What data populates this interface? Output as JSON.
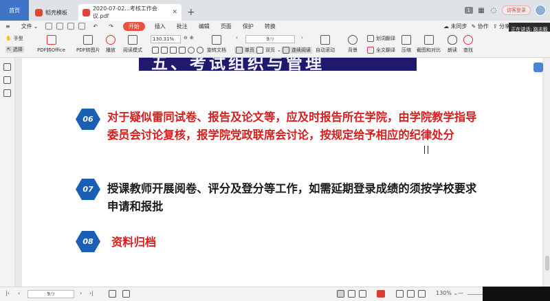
{
  "tabs": {
    "home": "首页",
    "template": "稻壳模板",
    "document": "2020-07-02...考核工作会议.pdf",
    "count_badge": "1",
    "login": "访客登录"
  },
  "menu": {
    "file": "文件",
    "start": "开始",
    "items": [
      "插入",
      "批注",
      "编辑",
      "页面",
      "保护",
      "转换"
    ],
    "sync": "未同步",
    "collab": "协作",
    "share": "分享"
  },
  "speaking_banner": "正在讲话: 路志毅",
  "toolbar": {
    "hand": "手型",
    "select": "选择",
    "pdf_to_office": "PDF转Office",
    "pdf_to_image": "PDF转图片",
    "play": "播放",
    "read_mode": "阅读模式",
    "zoom": "130.31%",
    "rotate": "旋转文档",
    "page_current": "9",
    "page_total": "/9",
    "single": "单页",
    "double": "双页",
    "continuous": "连续阅读",
    "auto_scroll": "自动滚动",
    "background": "背景",
    "word_translate": "划词翻译",
    "full_translate": "全文翻译",
    "compress": "压缩",
    "crop_compare": "截图和对比",
    "read_aloud": "朗读",
    "find": "查找"
  },
  "document": {
    "title": "五、考试组织与管理",
    "items": [
      {
        "num": "06",
        "lines": [
          "对于疑似雷同试卷、报告及论文等，应及时报告所在学院，由学院教学指导",
          "委员会讨论复核，报学院党政联席会讨论，按规定给予相应的纪律处分"
        ],
        "color": "#d81f1f"
      },
      {
        "num": "07",
        "lines": [
          "授课教师开展阅卷、评分及登分等工作，如需延期登录成绩的须按学校要求",
          "申请和报批"
        ],
        "color": "#1b1b1b"
      },
      {
        "num": "08",
        "lines": [
          "资料归档"
        ],
        "color": "#d81f1f"
      }
    ]
  },
  "statusbar": {
    "page_current": "9",
    "page_total": "/9",
    "zoom": "130%"
  }
}
